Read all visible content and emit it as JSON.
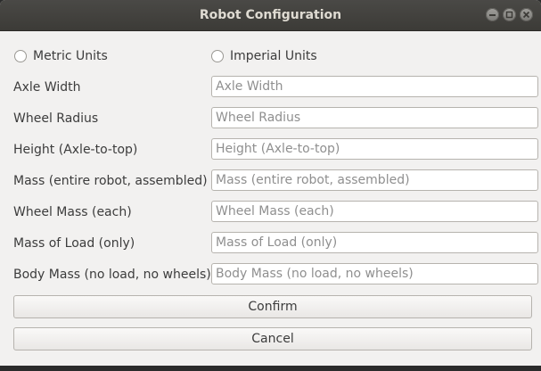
{
  "window": {
    "title": "Robot Configuration"
  },
  "icons": {
    "minimize": "minimize-icon",
    "maximize": "maximize-icon",
    "close": "close-icon"
  },
  "units": {
    "metric_label": "Metric Units",
    "imperial_label": "Imperial Units",
    "metric_selected": false,
    "imperial_selected": false
  },
  "fields": [
    {
      "label": "Axle Width",
      "placeholder": "Axle Width",
      "value": ""
    },
    {
      "label": "Wheel Radius",
      "placeholder": "Wheel Radius",
      "value": ""
    },
    {
      "label": "Height (Axle-to-top)",
      "placeholder": "Height (Axle-to-top)",
      "value": ""
    },
    {
      "label": "Mass (entire robot, assembled)",
      "placeholder": "Mass (entire robot, assembled)",
      "value": ""
    },
    {
      "label": "Wheel Mass (each)",
      "placeholder": "Wheel Mass (each)",
      "value": ""
    },
    {
      "label": "Mass of Load (only)",
      "placeholder": "Mass of Load (only)",
      "value": ""
    },
    {
      "label": "Body Mass (no load, no wheels)",
      "placeholder": "Body Mass (no load, no wheels)",
      "value": ""
    }
  ],
  "buttons": {
    "confirm_label": "Confirm",
    "cancel_label": "Cancel"
  },
  "colors": {
    "titlebar": "#3c3b37",
    "window_bg": "#f2f1f0",
    "title_text": "#dfdbd2"
  }
}
